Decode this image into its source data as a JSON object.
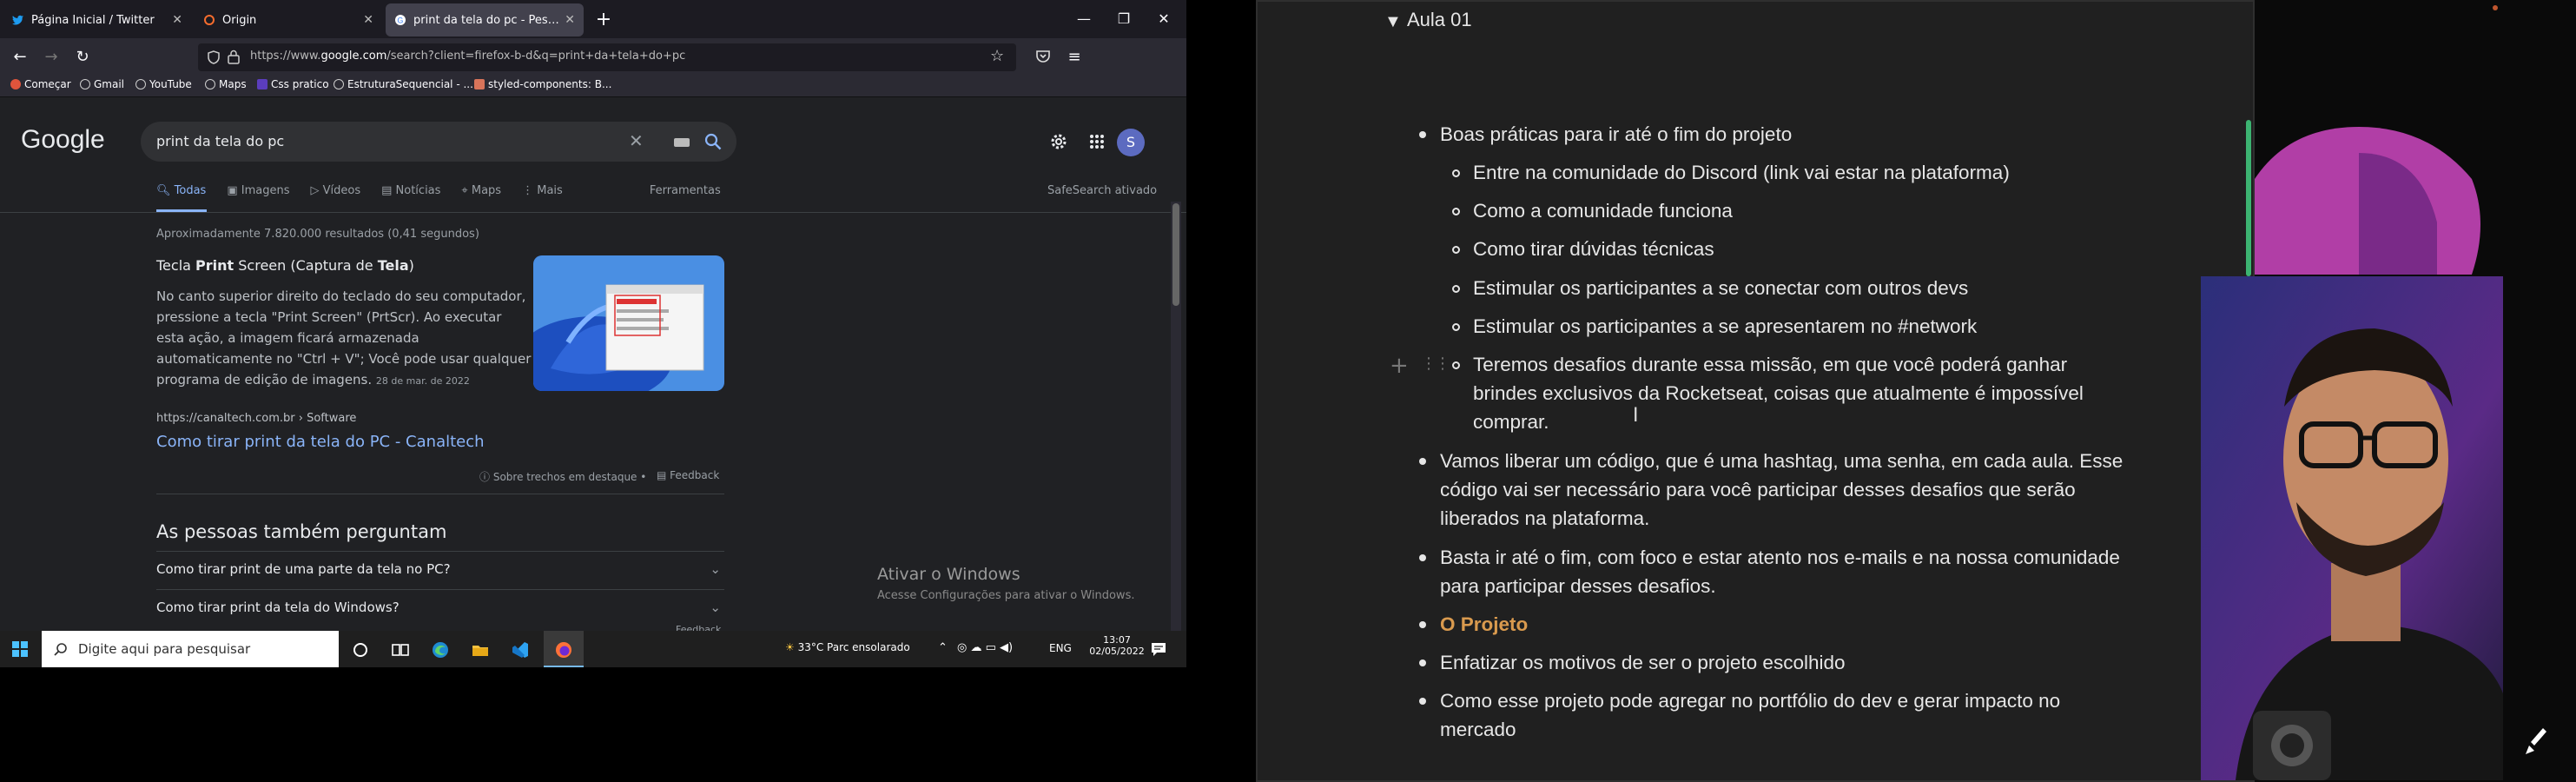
{
  "browser": {
    "tabs": [
      {
        "label": "Página Inicial / Twitter",
        "icon": "twitter-icon",
        "active": false
      },
      {
        "label": "Origin",
        "icon": "origin-icon",
        "active": false
      },
      {
        "label": "print da tela do pc - Pesquisa G",
        "icon": "google-icon",
        "active": true
      }
    ],
    "url_prefix": "https://www.",
    "url_domain": "google.com",
    "url_rest": "/search?client=firefox-b-d&q=print+da+tela+do+pc",
    "bookmarks": [
      "Começar",
      "Gmail",
      "YouTube",
      "Maps",
      "Css pratico",
      "EstruturaSequencial - ...",
      "styled-components: B..."
    ]
  },
  "google": {
    "logo": "Google",
    "query": "print da tela do pc",
    "avatar_letter": "S",
    "tabs": [
      "Todas",
      "Imagens",
      "Vídeos",
      "Notícias",
      "Maps",
      "Mais"
    ],
    "tools": "Ferramentas",
    "safesearch": "SafeSearch ativado",
    "results_count": "Aproximadamente 7.820.000 resultados (0,41 segundos)",
    "snippet": {
      "title_pre": "Tecla ",
      "title_b1": "Print",
      "title_mid": " Screen (Captura de ",
      "title_b2": "Tela",
      "title_post": ")",
      "lines": [
        "No canto superior direito do teclado do seu computador,",
        "pressione a tecla \"Print Screen\" (PrtScr). Ao executar",
        "esta ação, a imagem ficará armazenada",
        "automaticamente no \"Ctrl + V\"; Você pode usar qualquer",
        "programa de edição de imagens."
      ],
      "date": "28 de mar. de 2022",
      "source": "https://canaltech.com.br › Software",
      "link": "Como tirar print da tela do PC - Canaltech",
      "about": "Sobre trechos em destaque",
      "feedback": "Feedback"
    },
    "paa_title": "As pessoas também perguntam",
    "paa": [
      "Como tirar print de uma parte da tela no PC?",
      "Como tirar print da tela do Windows?"
    ],
    "paa_footer": "Feedback",
    "activate_title": "Ativar o Windows",
    "activate_sub": "Acesse Configurações para ativar o Windows."
  },
  "taskbar": {
    "search_placeholder": "Digite aqui para pesquisar",
    "weather": "33°C  Parc ensolarado",
    "lang": "ENG",
    "time": "13:07",
    "date": "02/05/2022"
  },
  "notion": {
    "toggle_title": "Aula 01",
    "items": [
      {
        "lines": [
          "Boas práticas para ir até o fim do projeto"
        ]
      }
    ],
    "subitems": [
      "Entre na comunidade do Discord (link vai estar na plataforma)",
      "Como a comunidade funciona",
      "Como tirar dúvidas técnicas",
      "Estimular os participantes a se conectar com outros devs",
      "Estimular os participantes a se apresentarem no #network"
    ],
    "sub6": [
      "Teremos desafios durante essa missão, em que você poderá ganhar",
      "brindes exclusivos da Rocketseat, coisas que atualmente é impossível",
      "comprar."
    ],
    "item2": [
      "Vamos liberar um código, que é uma hashtag, uma senha, em cada aula. Esse",
      "código vai ser necessário para você participar desses desafios que serão",
      "liberados na plataforma."
    ],
    "item3": [
      "Basta ir até o fim, com foco e estar atento nos e-mails e na nossa comunidade",
      "para participar desses desafios."
    ],
    "item4": "O Projeto",
    "item5": "Enfatizar os motivos de ser o projeto escolhido",
    "item6": [
      "Como esse projeto pode agregar no portfólio do dev e gerar impacto no",
      "mercado"
    ],
    "accent": "#d99a4e"
  }
}
